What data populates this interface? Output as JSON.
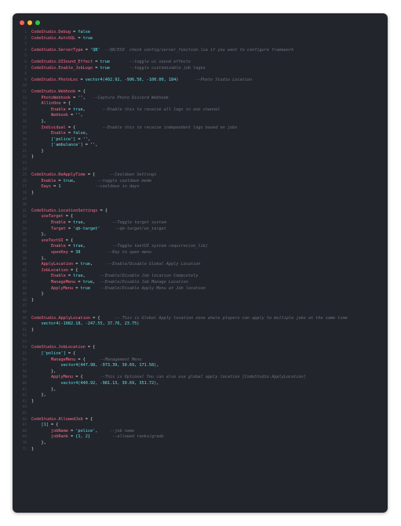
{
  "colors": {
    "background": "#23252c",
    "keyword": "#ff6b8a",
    "value": "#5fe0e8",
    "comment": "#6a707c",
    "text": "#c9c9c9",
    "line_number": "#4a4e58"
  },
  "window": {
    "controls": [
      "close",
      "minimize",
      "maximize"
    ]
  },
  "code_lines": [
    {
      "n": "1",
      "segments": [
        [
          "k",
          "CodeStudio.Debug"
        ],
        [
          "s",
          " = "
        ],
        [
          "v",
          "false"
        ]
      ]
    },
    {
      "n": "2",
      "segments": [
        [
          "k",
          "CodeStudio.AutoSQL"
        ],
        [
          "s",
          " = "
        ],
        [
          "v",
          "true"
        ]
      ]
    },
    {
      "n": "3",
      "segments": []
    },
    {
      "n": "4",
      "segments": [
        [
          "k",
          "CodeStudio.ServerType"
        ],
        [
          "s",
          " = "
        ],
        [
          "v",
          "'QB'"
        ],
        [
          "c",
          "  --QB/ESX  check config/server_function.lua if you want to configure framework"
        ]
      ]
    },
    {
      "n": "5",
      "segments": []
    },
    {
      "n": "6",
      "segments": [
        [
          "k",
          "CodeStudio.UISound_Effect"
        ],
        [
          "s",
          " = "
        ],
        [
          "v",
          "true"
        ],
        [
          "c",
          "        --toggle ui sound effects"
        ]
      ]
    },
    {
      "n": "7",
      "segments": [
        [
          "k",
          "CodeStudio.Enable_JobLogo"
        ],
        [
          "s",
          " = "
        ],
        [
          "v",
          "true"
        ],
        [
          "c",
          "        --toggle customizable job logos"
        ]
      ]
    },
    {
      "n": "8",
      "segments": []
    },
    {
      "n": "9",
      "segments": [
        [
          "k",
          "CodeStudio.PhotoLoc"
        ],
        [
          "s",
          " = "
        ],
        [
          "v",
          "vector4(402.92, -996.50, -100.00, 184)"
        ],
        [
          "c",
          "       --Photo Studio Location"
        ]
      ]
    },
    {
      "n": "10",
      "segments": []
    },
    {
      "n": "11",
      "segments": [
        [
          "k",
          "CodeStudio.Webhook"
        ],
        [
          "s",
          " = {"
        ]
      ]
    },
    {
      "n": "12",
      "segments": [
        [
          "k",
          "    PhotoWebhook"
        ],
        [
          "s",
          " = '',"
        ],
        [
          "c",
          "   --Capture Photo Discord Webhook"
        ]
      ]
    },
    {
      "n": "13",
      "segments": [
        [
          "k",
          "    AllinOne"
        ],
        [
          "s",
          " = {"
        ]
      ]
    },
    {
      "n": "14",
      "segments": [
        [
          "k",
          "        Enable"
        ],
        [
          "s",
          " = "
        ],
        [
          "v",
          "true"
        ],
        [
          "s",
          ","
        ],
        [
          "c",
          "       --Enable this to receive all logs in one channel"
        ]
      ]
    },
    {
      "n": "15",
      "segments": [
        [
          "k",
          "        Webhook"
        ],
        [
          "s",
          " = '',"
        ]
      ]
    },
    {
      "n": "16",
      "segments": [
        [
          "s",
          "    },"
        ]
      ]
    },
    {
      "n": "17",
      "segments": [
        [
          "k",
          "    Individual"
        ],
        [
          "s",
          " = {"
        ],
        [
          "c",
          "           --Enable this to receive independent logs based on jobs"
        ]
      ]
    },
    {
      "n": "18",
      "segments": [
        [
          "k",
          "        Enable"
        ],
        [
          "s",
          " = "
        ],
        [
          "v",
          "false"
        ],
        [
          "s",
          ","
        ]
      ]
    },
    {
      "n": "19",
      "segments": [
        [
          "v",
          "        ['police']"
        ],
        [
          "s",
          " = '',"
        ]
      ]
    },
    {
      "n": "20",
      "segments": [
        [
          "v",
          "        ['ambulance']"
        ],
        [
          "s",
          " = '',"
        ]
      ]
    },
    {
      "n": "21",
      "segments": [
        [
          "s",
          "    }"
        ]
      ]
    },
    {
      "n": "22",
      "segments": [
        [
          "s",
          "}"
        ]
      ]
    },
    {
      "n": "23",
      "segments": []
    },
    {
      "n": "24",
      "segments": []
    },
    {
      "n": "25",
      "segments": [
        [
          "k",
          "CodeStudio.ReApplyTime"
        ],
        [
          "s",
          " = {"
        ],
        [
          "c",
          "      --Cooldown Settings"
        ]
      ]
    },
    {
      "n": "26",
      "segments": [
        [
          "k",
          "    Enable"
        ],
        [
          "s",
          " = "
        ],
        [
          "v",
          "true"
        ],
        [
          "s",
          ","
        ],
        [
          "c",
          "         --toggle cooldown mode"
        ]
      ]
    },
    {
      "n": "27",
      "segments": [
        [
          "k",
          "    Days"
        ],
        [
          "s",
          " = "
        ],
        [
          "v",
          "1"
        ],
        [
          "c",
          "              --cooldown in days"
        ]
      ]
    },
    {
      "n": "28",
      "segments": [
        [
          "s",
          "}"
        ]
      ]
    },
    {
      "n": "29",
      "segments": []
    },
    {
      "n": "30",
      "segments": []
    },
    {
      "n": "31",
      "segments": [
        [
          "k",
          "CodeStudio.LocationSettings"
        ],
        [
          "s",
          " = {"
        ]
      ]
    },
    {
      "n": "32",
      "segments": [
        [
          "k",
          "    useTarget"
        ],
        [
          "s",
          " = {"
        ]
      ]
    },
    {
      "n": "33",
      "segments": [
        [
          "k",
          "        Enable"
        ],
        [
          "s",
          " = "
        ],
        [
          "v",
          "true"
        ],
        [
          "s",
          ","
        ],
        [
          "c",
          "           --Toggle target system"
        ]
      ]
    },
    {
      "n": "34",
      "segments": [
        [
          "k",
          "        Target"
        ],
        [
          "s",
          " = "
        ],
        [
          "v",
          "'qb-target'"
        ],
        [
          "c",
          "      --qb-target/ox_target"
        ]
      ]
    },
    {
      "n": "35",
      "segments": [
        [
          "s",
          "    },"
        ]
      ]
    },
    {
      "n": "36",
      "segments": [
        [
          "k",
          "    useTextUI"
        ],
        [
          "s",
          " = {"
        ]
      ]
    },
    {
      "n": "37",
      "segments": [
        [
          "k",
          "        Enable"
        ],
        [
          "s",
          " = "
        ],
        [
          "v",
          "true"
        ],
        [
          "s",
          ","
        ],
        [
          "c",
          "           --Toggle textUI system requires(ox_lib)"
        ]
      ]
    },
    {
      "n": "38",
      "segments": [
        [
          "k",
          "        openKey"
        ],
        [
          "s",
          " = "
        ],
        [
          "v",
          "38"
        ],
        [
          "c",
          "           --Key to open menu"
        ]
      ]
    },
    {
      "n": "39",
      "segments": [
        [
          "s",
          "    },"
        ]
      ]
    },
    {
      "n": "40",
      "segments": [
        [
          "k",
          "    ApplyLocation"
        ],
        [
          "s",
          " = "
        ],
        [
          "v",
          "true"
        ],
        [
          "s",
          ","
        ],
        [
          "c",
          "      --Enable/Disable Global Apply Location"
        ]
      ]
    },
    {
      "n": "41",
      "segments": [
        [
          "k",
          "    JobLocation"
        ],
        [
          "s",
          " = {"
        ]
      ]
    },
    {
      "n": "42",
      "segments": [
        [
          "k",
          "        Enable"
        ],
        [
          "s",
          " = "
        ],
        [
          "v",
          "true"
        ],
        [
          "s",
          ","
        ],
        [
          "c",
          "      --Enable/Disable Job location Compcetely"
        ]
      ]
    },
    {
      "n": "43",
      "segments": [
        [
          "k",
          "        ManageMenu"
        ],
        [
          "s",
          " = "
        ],
        [
          "v",
          "true"
        ],
        [
          "s",
          ","
        ],
        [
          "c",
          "  --Enable/Disable Job Manage Location"
        ]
      ]
    },
    {
      "n": "44",
      "segments": [
        [
          "k",
          "        ApplyMenu"
        ],
        [
          "s",
          " = "
        ],
        [
          "v",
          "true"
        ],
        [
          "c",
          "    --Enable/Disable Apply Menu at Job location"
        ]
      ]
    },
    {
      "n": "45",
      "segments": [
        [
          "s",
          "    }"
        ]
      ]
    },
    {
      "n": "46",
      "segments": [
        [
          "s",
          "}"
        ]
      ]
    },
    {
      "n": "47",
      "segments": []
    },
    {
      "n": "48",
      "segments": []
    },
    {
      "n": "49",
      "segments": [
        [
          "k",
          "CodeStudio.ApplyLocation"
        ],
        [
          "s",
          " = {"
        ],
        [
          "c",
          "      -- This is Global Apply location zone where players can apply to multiple jobs at the same time"
        ]
      ]
    },
    {
      "n": "50",
      "segments": [
        [
          "v",
          "    vector4(-1082.18, -247.55, 37.76, 23.75)"
        ]
      ]
    },
    {
      "n": "51",
      "segments": [
        [
          "s",
          "}"
        ]
      ]
    },
    {
      "n": "52",
      "segments": []
    },
    {
      "n": "53",
      "segments": []
    },
    {
      "n": "54",
      "segments": [
        [
          "k",
          "CodeStudio.JobLocation"
        ],
        [
          "s",
          " = {"
        ]
      ]
    },
    {
      "n": "55",
      "segments": [
        [
          "v",
          "    ['police']"
        ],
        [
          "s",
          " = {"
        ]
      ]
    },
    {
      "n": "56",
      "segments": [
        [
          "k",
          "        ManageMenu"
        ],
        [
          "s",
          " = {"
        ],
        [
          "c",
          "      --Management Menu"
        ]
      ]
    },
    {
      "n": "57",
      "segments": [
        [
          "v",
          "            vector4(447.98, -973.39, 30.69, 171.58)"
        ],
        [
          "s",
          ","
        ]
      ]
    },
    {
      "n": "58",
      "segments": [
        [
          "s",
          "        },"
        ]
      ]
    },
    {
      "n": "59",
      "segments": [
        [
          "k",
          "        ApplyMenu"
        ],
        [
          "s",
          " = {"
        ],
        [
          "c",
          "       --This is Optional You can also use global apply location [CodeStudio.ApplyLocation]"
        ]
      ]
    },
    {
      "n": "60",
      "segments": [
        [
          "v",
          "            vector4(440.92, -981.13, 30.69, 351.72)"
        ],
        [
          "s",
          ","
        ]
      ]
    },
    {
      "n": "61",
      "segments": [
        [
          "s",
          "        },"
        ]
      ]
    },
    {
      "n": "62",
      "segments": [
        [
          "s",
          "    },"
        ]
      ]
    },
    {
      "n": "63",
      "segments": [
        [
          "s",
          "}"
        ]
      ]
    },
    {
      "n": "64",
      "segments": []
    },
    {
      "n": "65",
      "segments": []
    },
    {
      "n": "66",
      "segments": [
        [
          "k",
          "CodeStudio.AllowedJob"
        ],
        [
          "s",
          " = {"
        ]
      ]
    },
    {
      "n": "67",
      "segments": [
        [
          "v",
          "    [1]"
        ],
        [
          "s",
          " = {"
        ]
      ]
    },
    {
      "n": "68",
      "segments": [
        [
          "k",
          "        jobName"
        ],
        [
          "s",
          " = "
        ],
        [
          "v",
          "'police'"
        ],
        [
          "s",
          ","
        ],
        [
          "c",
          "     --job name"
        ]
      ]
    },
    {
      "n": "69",
      "segments": [
        [
          "k",
          "        jobRank"
        ],
        [
          "s",
          " = "
        ],
        [
          "v",
          "{1, 2}"
        ],
        [
          "c",
          "         --allowed ranks/grade"
        ]
      ]
    },
    {
      "n": "70",
      "segments": [
        [
          "s",
          "    },"
        ]
      ]
    },
    {
      "n": "71",
      "segments": [
        [
          "s",
          "}"
        ]
      ]
    }
  ]
}
